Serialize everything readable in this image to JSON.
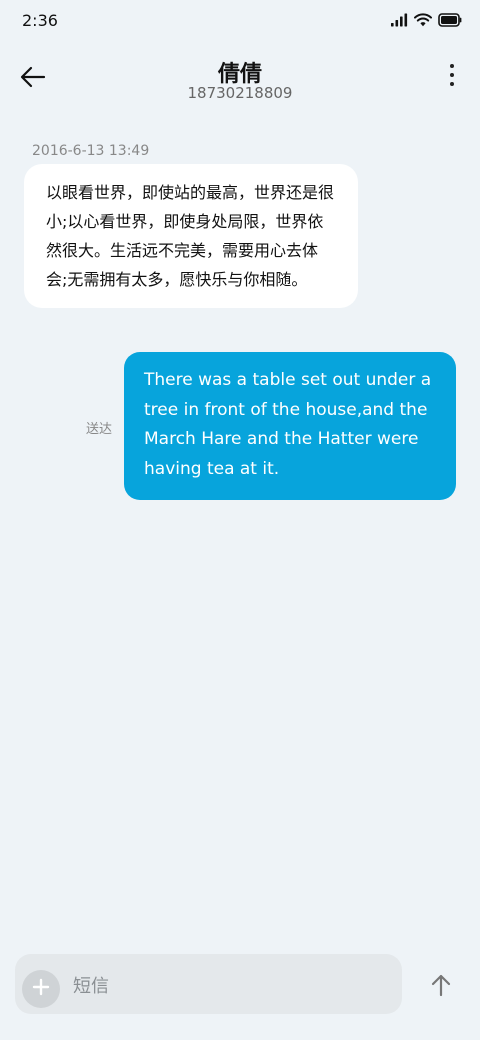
{
  "status_bar": {
    "time": "2:36"
  },
  "header": {
    "contact_name": "倩倩",
    "contact_number": "18730218809"
  },
  "messages": [
    {
      "direction": "incoming",
      "timestamp": "2016-6-13 13:49",
      "text": "以眼看世界，即使站的最高，世界还是很小;以心看世界，即使身处局限，世界依然很大。生活远不完美，需要用心去体会;无需拥有太多，愿快乐与你相随。"
    },
    {
      "direction": "outgoing",
      "status": "送达",
      "text": "There was a table set out under a tree in front of the house,and the March Hare and the Hatter were having tea at it."
    }
  ],
  "composer": {
    "placeholder": "短信"
  },
  "colors": {
    "background": "#eef3f7",
    "incoming_bubble": "#ffffff",
    "outgoing_bubble": "#07a4dc",
    "composer_bg": "#e4e8eb"
  },
  "icons": {
    "back": "arrow-left-icon",
    "more": "more-vertical-icon",
    "attach": "plus-icon",
    "send": "arrow-up-icon",
    "signal": "signal-icon",
    "wifi": "wifi-icon",
    "battery": "battery-icon"
  }
}
